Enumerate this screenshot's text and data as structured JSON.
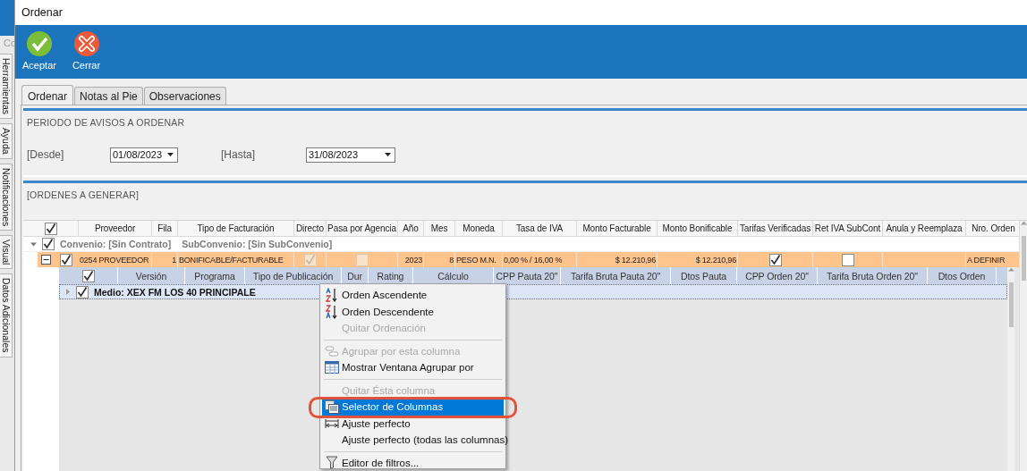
{
  "background_app": {
    "label": "Co",
    "side_tabs": [
      {
        "label": "Herramientas"
      },
      {
        "label": "Ayuda"
      },
      {
        "label": "Notificaciones"
      },
      {
        "label": "Visual"
      },
      {
        "label": "Datos Adicionales"
      }
    ]
  },
  "window": {
    "title": "Ordenar"
  },
  "toolbar": [
    {
      "label": "Aceptar",
      "kind": "accept"
    },
    {
      "label": "Cerrar",
      "kind": "close"
    }
  ],
  "tabs": [
    {
      "label": "Ordenar",
      "selected": true
    },
    {
      "label": "Notas al Pie",
      "selected": false
    },
    {
      "label": "Observaciones",
      "selected": false
    }
  ],
  "period": {
    "title": "PERIODO DE AVISOS A ORDENAR",
    "from_label": "[Desde]",
    "from_value": "01/08/2023",
    "to_label": "[Hasta]",
    "to_value": "31/08/2023"
  },
  "orders": {
    "title": "[ORDENES A GENERAR]",
    "header_checked": true,
    "columns": [
      "Proveedor",
      "Fila",
      "Tipo de Facturación",
      "Directo",
      "Pasa por Agencia",
      "Año",
      "Mes",
      "Moneda",
      "Tasa de IVA",
      "Monto Facturable",
      "Monto Bonificable",
      "Tarifas Verificadas",
      "Ret IVA SubCont",
      "Anula y Reemplaza",
      "Nro. Orden"
    ],
    "group": {
      "expanded": true,
      "checked": true,
      "text": "Convenio: [Sin Contrato]",
      "subtext": "SubConvenio: [Sin SubConvenio]"
    },
    "rows": [
      {
        "expanded": true,
        "checked": true,
        "selected": true,
        "cells": [
          {
            "kind": "text",
            "text": "0254 PROVEEDOR"
          },
          {
            "kind": "number",
            "text": "1"
          },
          {
            "kind": "text",
            "text": "BONIFICABLE/FACTURABLE"
          },
          {
            "kind": "check",
            "checked": true,
            "disabled": true
          },
          {
            "kind": "check",
            "checked": false,
            "disabled": true
          },
          {
            "kind": "number",
            "text": "2023"
          },
          {
            "kind": "number",
            "text": "8"
          },
          {
            "kind": "text",
            "text": "PESO M.N."
          },
          {
            "kind": "text",
            "text": "0,00 % / 16,00 %"
          },
          {
            "kind": "number",
            "text": "$ 12.210,96"
          },
          {
            "kind": "number",
            "text": "$ 12.210,96"
          },
          {
            "kind": "check",
            "checked": true,
            "disabled": false
          },
          {
            "kind": "check",
            "checked": false,
            "disabled": false
          },
          {
            "kind": "empty"
          },
          {
            "kind": "text",
            "text": "A DEFINIR"
          }
        ]
      }
    ]
  },
  "detail": {
    "header_checked": true,
    "columns": [
      "Versión",
      "Programa",
      "Tipo de Publicación",
      "Dur",
      "Rating",
      "Cálculo",
      "CPP Pauta 20\"",
      "Tarifa Bruta Pauta 20\"",
      "Dtos Pauta",
      "CPP Orden 20\"",
      "Tarifa Bruta Orden 20\"",
      "Dtos Orden"
    ],
    "group": {
      "expanded": false,
      "checked": true,
      "text": "Medio: XEX FM LOS 40 PRINCIPALE"
    }
  },
  "context_menu": {
    "groups": [
      [
        {
          "label": "Orden Ascendente",
          "disabled": false,
          "selected": false
        },
        {
          "label": "Orden Descendente",
          "disabled": false,
          "selected": false
        },
        {
          "label": "Quitar Ordenación",
          "disabled": true,
          "selected": false
        }
      ],
      [
        {
          "label": "Agrupar por esta columna",
          "disabled": true,
          "selected": false
        },
        {
          "label": "Mostrar Ventana Agrupar por",
          "disabled": false,
          "selected": false
        }
      ],
      [
        {
          "label": "Quitar Ésta columna",
          "disabled": true,
          "selected": false
        },
        {
          "label": "Selector de Columnas",
          "disabled": false,
          "selected": true
        },
        {
          "label": "Ajuste perfecto",
          "disabled": false,
          "selected": false
        },
        {
          "label": "Ajuste perfecto (todas las columnas)",
          "disabled": false,
          "selected": false
        }
      ],
      [
        {
          "label": "Editor de filtros...",
          "disabled": false,
          "selected": false
        }
      ]
    ]
  }
}
